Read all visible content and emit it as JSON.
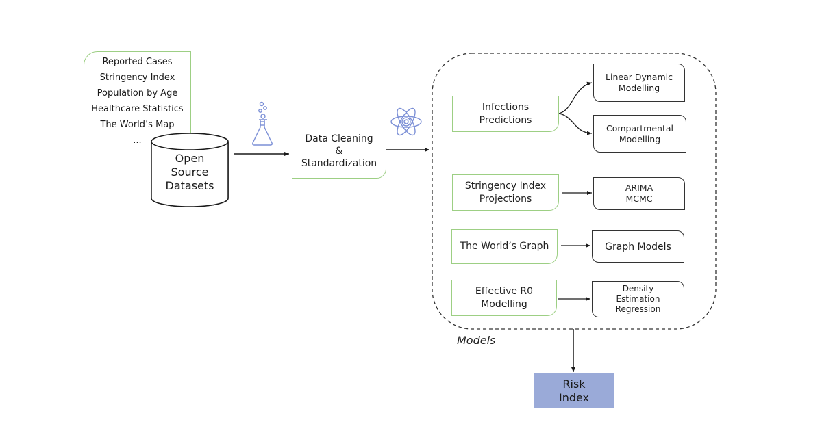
{
  "diagram": {
    "data_sources": {
      "items": [
        "Reported Cases",
        "Stringency Index",
        "Population by Age",
        "Healthcare Statistics",
        "The World’s Map",
        "..."
      ]
    },
    "database": {
      "line1": "Open",
      "line2": "Source",
      "line3": "Datasets",
      "icon": "database-cylinder-icon"
    },
    "flask_icon": "flask-icon",
    "atom_icon": "atom-icon",
    "cleaning": {
      "line1": "Data Cleaning",
      "line2": "&",
      "line3": "Standardization"
    },
    "models_group": {
      "label": "Models",
      "tasks": [
        {
          "line1": "Infections",
          "line2": "Predictions",
          "targets": [
            {
              "line1": "Linear Dynamic",
              "line2": "Modelling"
            },
            {
              "line1": "Compartmental",
              "line2": "Modelling"
            }
          ]
        },
        {
          "line1": "Stringency Index",
          "line2": "Projections",
          "targets": [
            {
              "line1": "ARIMA",
              "line2": "MCMC"
            }
          ]
        },
        {
          "line1": "The World’s Graph",
          "line2": "",
          "targets": [
            {
              "line1": "Graph Models",
              "line2": ""
            }
          ]
        },
        {
          "line1": "Effective R0",
          "line2": "Modelling",
          "targets": [
            {
              "line1": "Density",
              "line2": "Estimation",
              "line3": "Regression"
            }
          ]
        }
      ]
    },
    "output": {
      "line1": "Risk",
      "line2": "Index"
    },
    "colors": {
      "source_border": "#9dcf84",
      "model_border": "#333333",
      "icon_blue": "#7b8fd6",
      "risk_fill": "#9aaad8"
    }
  }
}
